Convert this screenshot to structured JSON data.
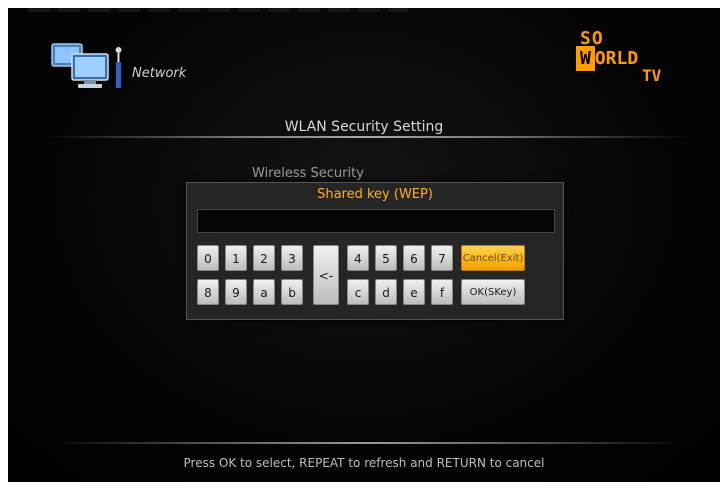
{
  "header": {
    "network_label": "Network",
    "logo_line1": "SO",
    "logo_line2": "WORLD",
    "logo_line3": "TV"
  },
  "page": {
    "title": "WLAN Security Setting",
    "field_label": "Wireless Security"
  },
  "dialog": {
    "title": "Shared key (WEP)",
    "input_value": "",
    "row1_keys": [
      "0",
      "1",
      "2",
      "3",
      "4",
      "5",
      "6",
      "7"
    ],
    "row2_keys": [
      "8",
      "9",
      "a",
      "b",
      "c",
      "d",
      "e",
      "f"
    ],
    "backspace_label": "<-",
    "cancel_label": "Cancel(Exit)",
    "ok_label": "OK(SKey)"
  },
  "footer": {
    "hint": "Press OK to select, REPEAT to refresh and RETURN to cancel"
  },
  "colors": {
    "accent": "#ffb020",
    "logo": "#ff9a00",
    "background": "#000000"
  },
  "icons": [
    "network-computers-icon"
  ]
}
